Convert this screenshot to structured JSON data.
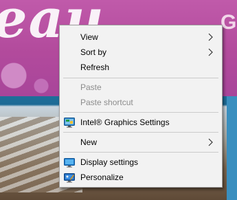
{
  "menu": {
    "items": [
      {
        "label": "View",
        "submenu": true,
        "enabled": true
      },
      {
        "label": "Sort by",
        "submenu": true,
        "enabled": true
      },
      {
        "label": "Refresh",
        "submenu": false,
        "enabled": true
      },
      {
        "label": "Paste",
        "submenu": false,
        "enabled": false
      },
      {
        "label": "Paste shortcut",
        "submenu": false,
        "enabled": false
      },
      {
        "label": "Intel® Graphics Settings",
        "submenu": false,
        "enabled": true,
        "icon": "intel-graphics-icon"
      },
      {
        "label": "New",
        "submenu": true,
        "enabled": true
      },
      {
        "label": "Display settings",
        "submenu": false,
        "enabled": true,
        "icon": "display-settings-icon"
      },
      {
        "label": "Personalize",
        "submenu": false,
        "enabled": true,
        "icon": "personalize-icon"
      }
    ]
  },
  "colors": {
    "menu_bg": "#f2f2f2",
    "disabled_text": "#8c8c8c",
    "separator": "#cbcbcb"
  }
}
